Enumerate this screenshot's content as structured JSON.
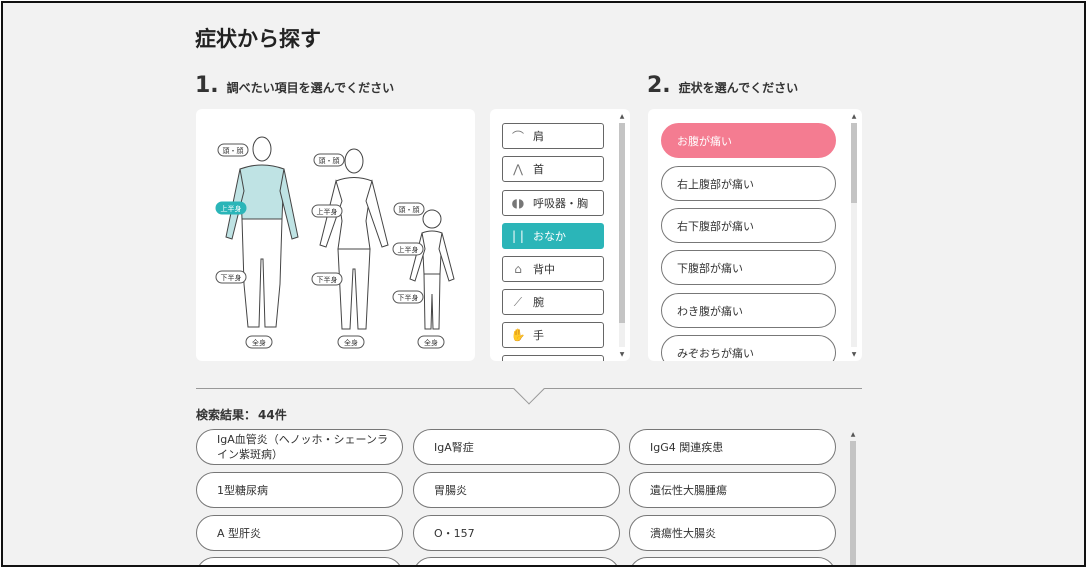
{
  "title": "症状から探す",
  "step1": {
    "num": "1.",
    "label": "調べたい項目を選んでください"
  },
  "step2": {
    "num": "2.",
    "label": "症状を選んでください"
  },
  "figure_labels": {
    "adult_male": {
      "head": "頭・顔",
      "upper": "上半身",
      "lower": "下半身",
      "whole": "全身"
    },
    "adult_female": {
      "head": "頭・顔",
      "upper": "上半身",
      "lower": "下半身",
      "whole": "全身"
    },
    "child": {
      "head": "頭・顔",
      "upper": "上半身",
      "lower": "下半身",
      "whole": "全身"
    }
  },
  "colors": {
    "teal": "#2bb5b8",
    "pink": "#f47c91",
    "body_highlight": "#bfe3e4"
  },
  "parts": [
    {
      "label": "肩",
      "icon": "shoulder-icon",
      "active": false
    },
    {
      "label": "首",
      "icon": "neck-icon",
      "active": false
    },
    {
      "label": "呼吸器・胸",
      "icon": "lungs-icon",
      "active": false
    },
    {
      "label": "おなか",
      "icon": "abdomen-icon",
      "active": true
    },
    {
      "label": "背中",
      "icon": "back-icon",
      "active": false
    },
    {
      "label": "腕",
      "icon": "arm-icon",
      "active": false
    },
    {
      "label": "手",
      "icon": "hand-icon",
      "active": false
    }
  ],
  "symptoms": [
    {
      "label": "お腹が痛い",
      "active": true
    },
    {
      "label": "右上腹部が痛い",
      "active": false
    },
    {
      "label": "右下腹部が痛い",
      "active": false
    },
    {
      "label": "下腹部が痛い",
      "active": false
    },
    {
      "label": "わき腹が痛い",
      "active": false
    },
    {
      "label": "みぞおちが痛い",
      "active": false
    }
  ],
  "results": {
    "label": "検索結果：",
    "count": "44件",
    "items": [
      "IgA血管炎（ヘノッホ・シェーンライン紫斑病）",
      "IgA腎症",
      "IgG4 関連疾患",
      "1型糖尿病",
      "胃腸炎",
      "遺伝性大腸腫瘍",
      "A 型肝炎",
      "O・157",
      "潰瘍性大腸炎"
    ]
  }
}
